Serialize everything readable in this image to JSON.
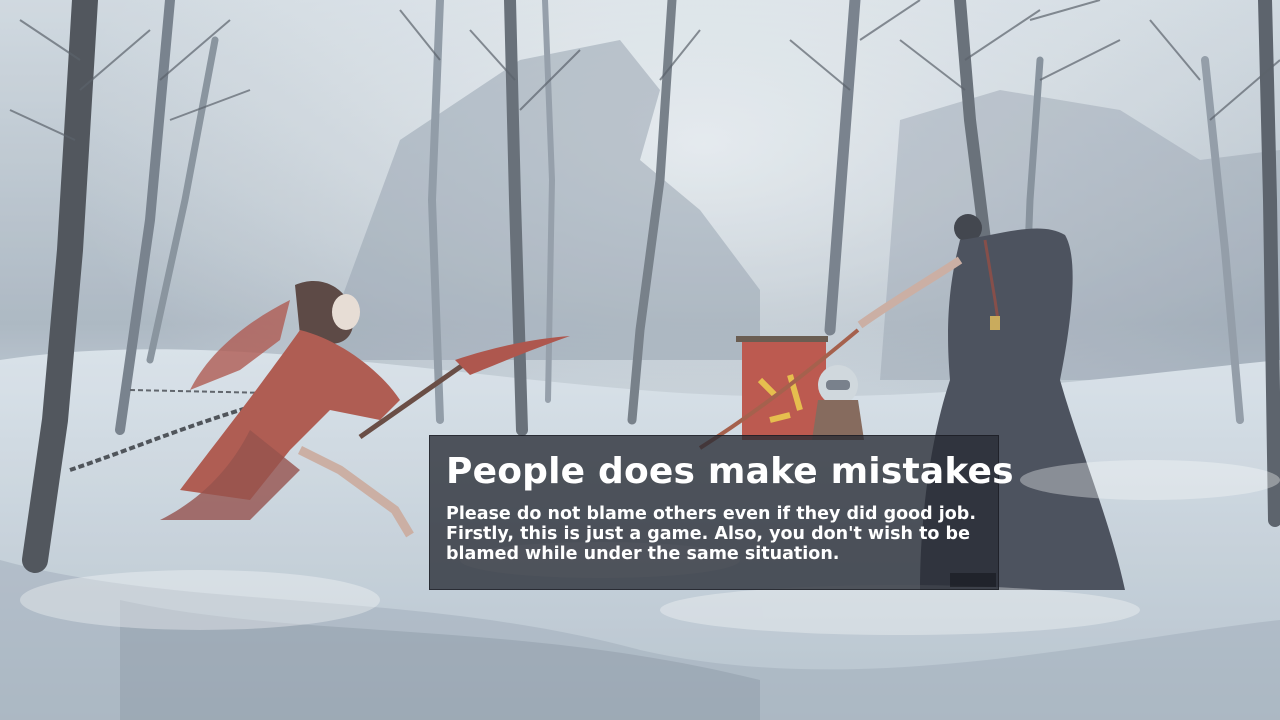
{
  "loading_tip": {
    "title": "People does make mistakes",
    "body_lines": [
      "Please do not blame others even if they did good job.",
      "Firstly, this is just a game. Also, you don't wish to be",
      "blamed while under the same situation."
    ]
  },
  "background": {
    "description_icon": "snowy-forest-duel-artwork",
    "colors": {
      "sky": "#c9d3dc",
      "fog": "#a9b5c1",
      "snow": "#e4ebf1",
      "trunk": "#4a4f57",
      "red_robe": "#a94a3f",
      "dark_robe": "#3a3f4d",
      "banner": "#b8473c"
    }
  }
}
